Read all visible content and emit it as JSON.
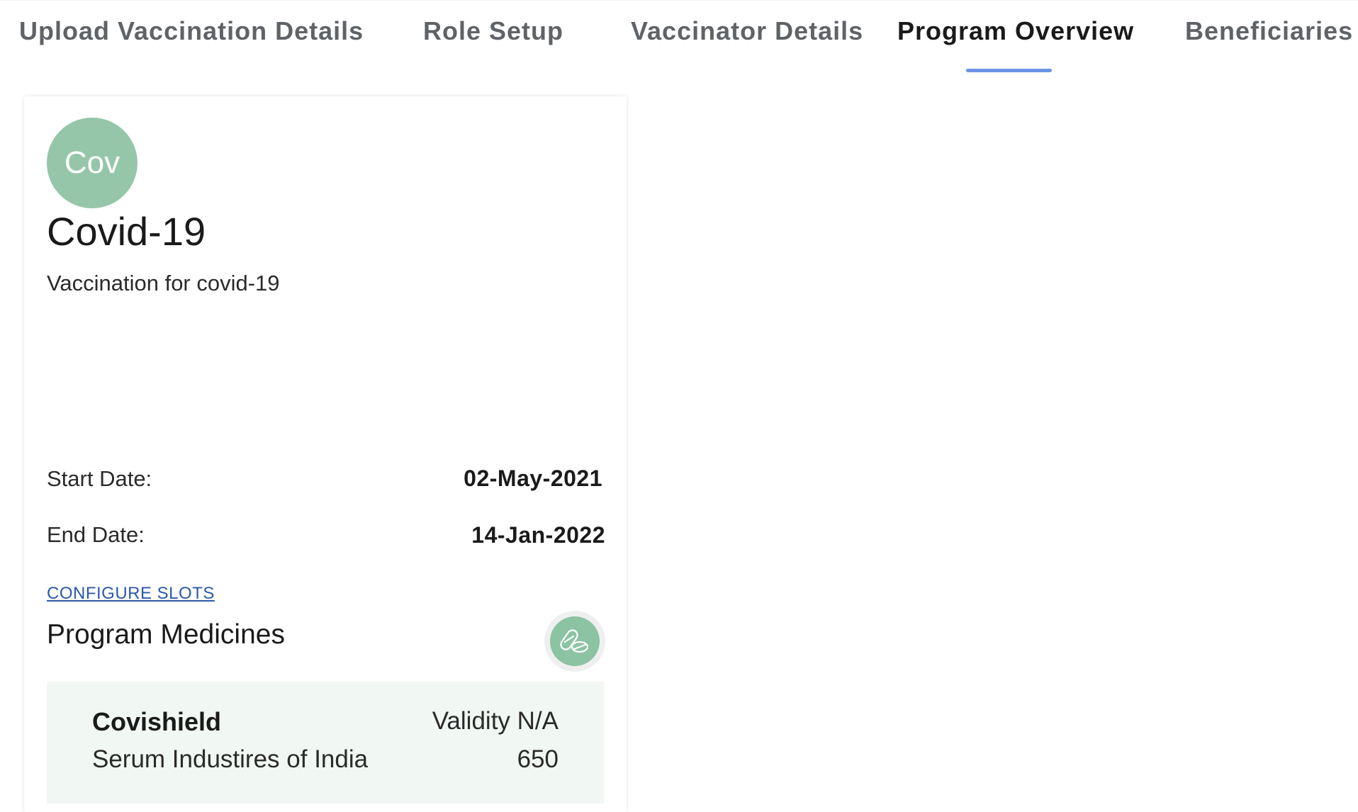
{
  "tabs": [
    {
      "label": "Upload Vaccination Details",
      "active": false
    },
    {
      "label": "Role Setup",
      "active": false
    },
    {
      "label": "Vaccinator Details",
      "active": false
    },
    {
      "label": "Program Overview",
      "active": true
    },
    {
      "label": "Beneficiaries",
      "active": false
    }
  ],
  "program": {
    "avatar_text": "Cov",
    "avatar_color": "#95c6aa",
    "name": "Covid-19",
    "description": "Vaccination for covid-19",
    "start_date_label": "Start Date:",
    "start_date": "02-May-2021",
    "end_date_label": "End Date:",
    "end_date": "14-Jan-2022",
    "configure_slots_label": "CONFIGURE SLOTS",
    "medicines_title": "Program Medicines",
    "add_medicine_icon": "pill-icon",
    "medicines": [
      {
        "name": "Covishield",
        "manufacturer": "Serum Industires of India",
        "validity": "Validity N/A",
        "price": "650"
      }
    ]
  },
  "colors": {
    "accent": "#6b93e6",
    "link": "#2b59a8",
    "medicine_bg": "#f1f7f3"
  }
}
